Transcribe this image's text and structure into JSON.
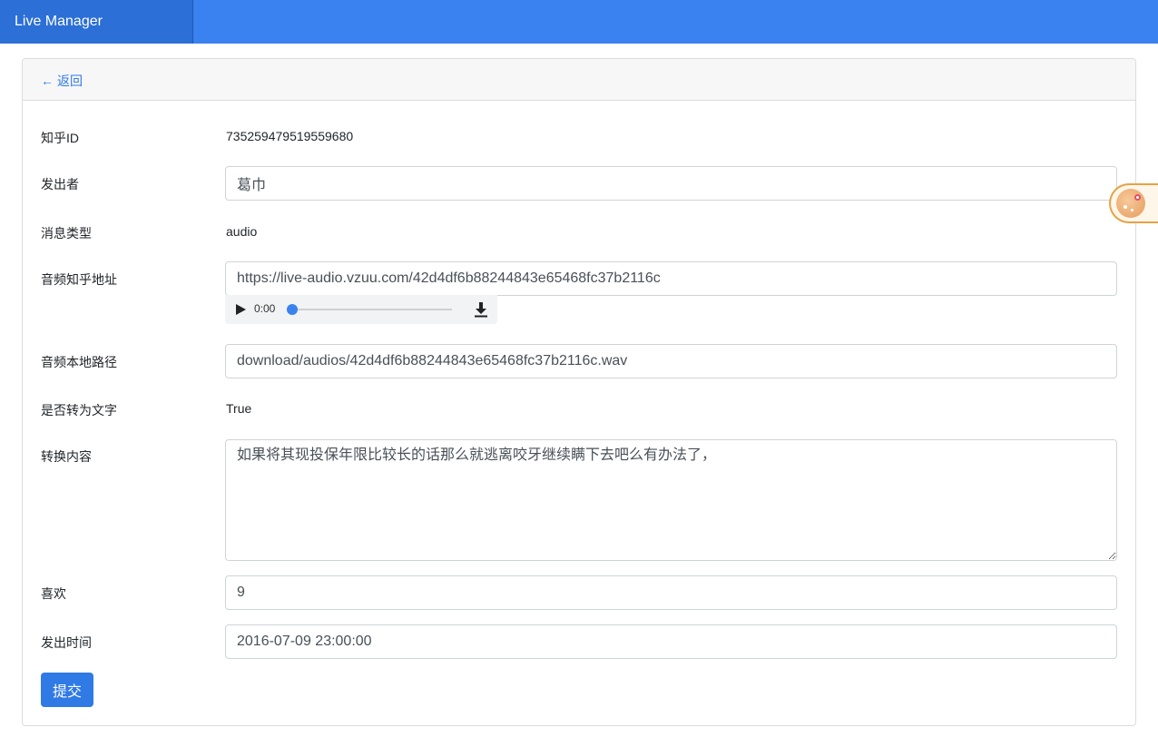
{
  "app": {
    "brand": "Live Manager"
  },
  "header": {
    "back_label": "返回"
  },
  "form": {
    "zhihu_id": {
      "label": "知乎ID",
      "value": "735259479519559680"
    },
    "sender": {
      "label": "发出者",
      "value": "葛巾"
    },
    "message_type": {
      "label": "消息类型",
      "value": "audio"
    },
    "audio_url": {
      "label": "音频知乎地址",
      "value": "https://live-audio.vzuu.com/42d4df6b88244843e65468fc37b2116c"
    },
    "audio_player": {
      "time": "0:00",
      "progress": 0
    },
    "audio_local_path": {
      "label": "音频本地路径",
      "value": "download/audios/42d4df6b88244843e65468fc37b2116c.wav"
    },
    "converted": {
      "label": "是否转为文字",
      "value": "True"
    },
    "content": {
      "label": "转换内容",
      "value": "如果将其现投保年限比较长的话那么就逃离咬牙继续瞒下去吧么有办法了，"
    },
    "likes": {
      "label": "喜欢",
      "value": "9"
    },
    "sent_time": {
      "label": "发出时间",
      "value": "2016-07-09 23:00:00"
    },
    "submit_label": "提交"
  },
  "icons": {
    "back": "arrow-left-icon",
    "play": "play-icon",
    "download": "download-icon",
    "floating": "floating-assistant-icon"
  },
  "colors": {
    "navbar": "#3a82ef",
    "brand_bg": "#2c6fd6",
    "primary": "#2f7ae5",
    "card_header": "#f7f7f7"
  }
}
